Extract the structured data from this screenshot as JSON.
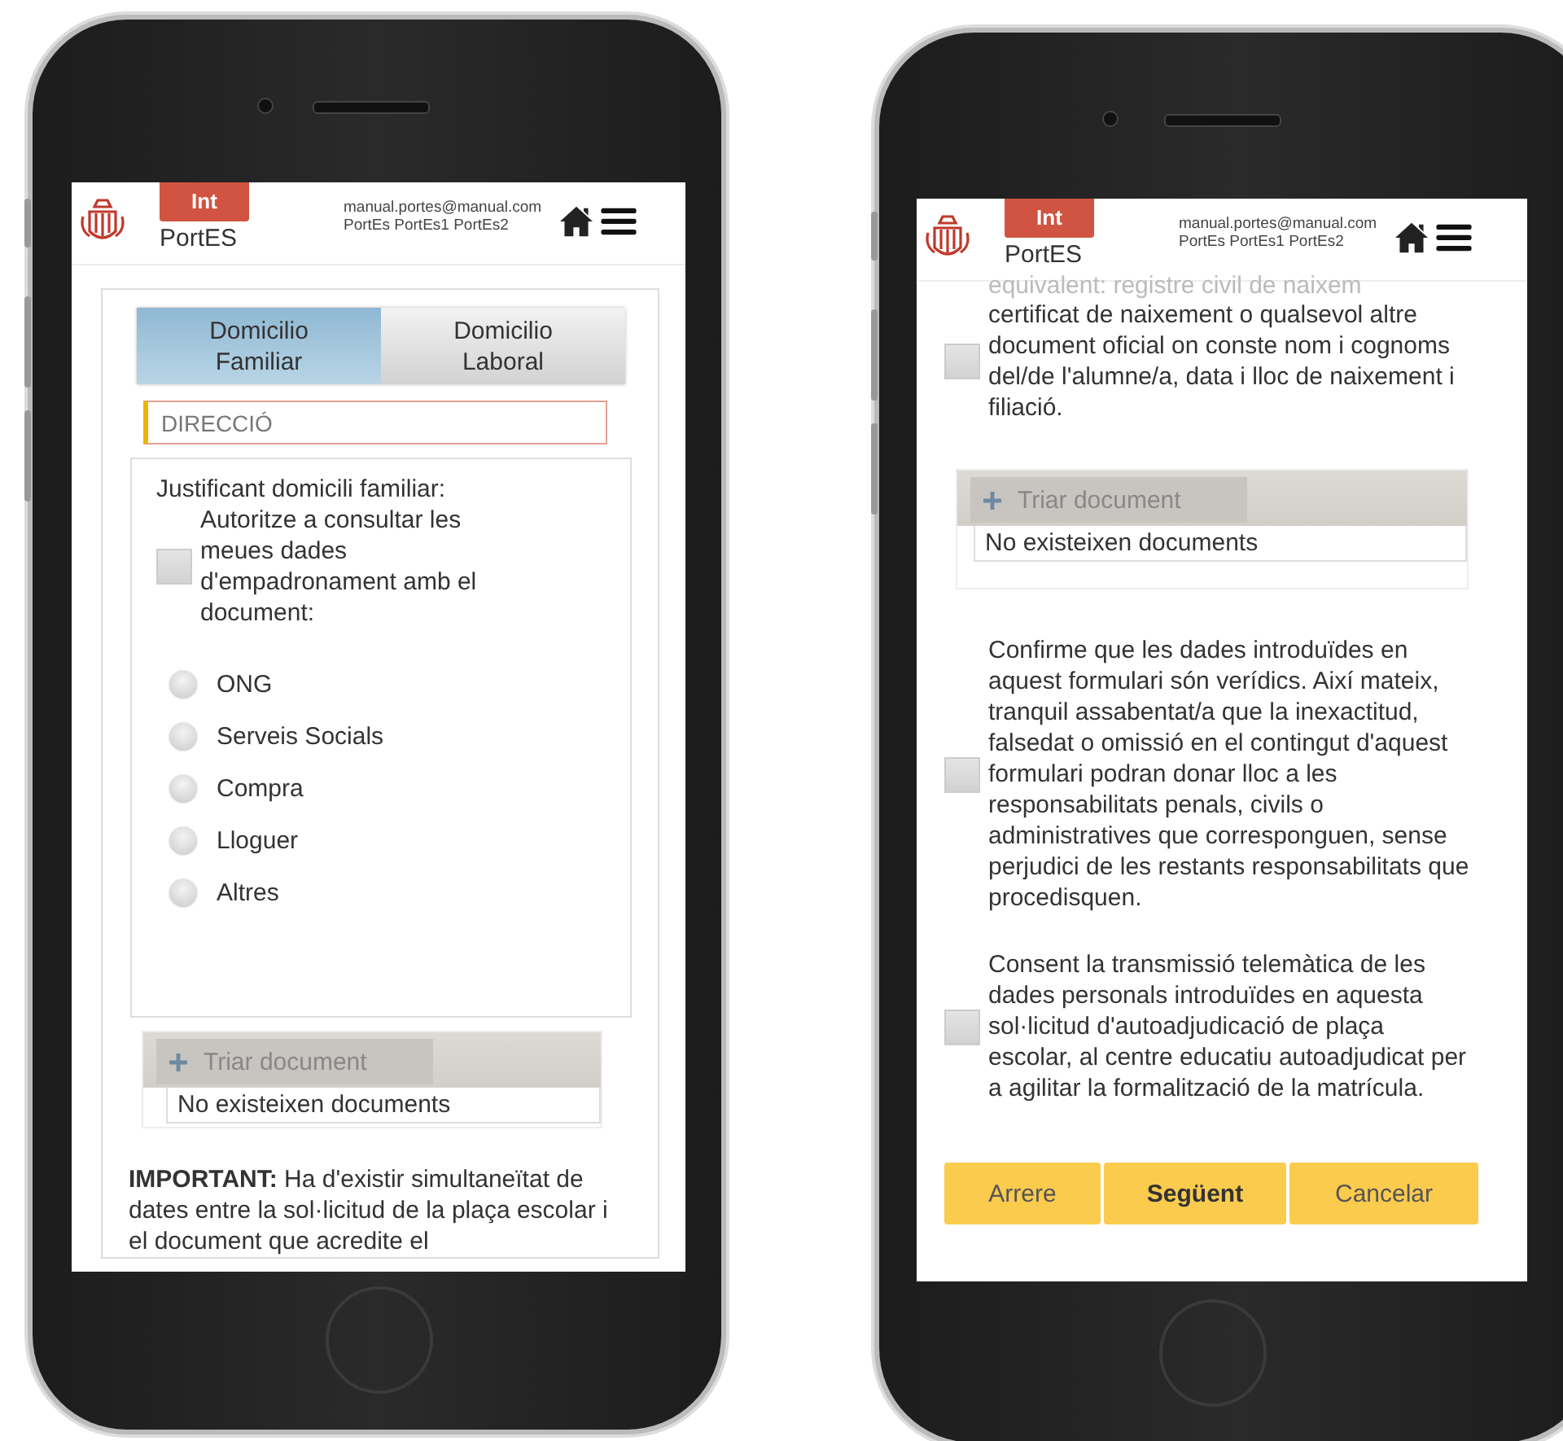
{
  "left_screen": {
    "header": {
      "badge": "Int",
      "app_name": "PortES",
      "email": "manual.portes@manual.com",
      "users": "PortEs PortEs1 PortEs2"
    },
    "tabs": [
      {
        "label": "Domicilio Familiar",
        "selected": true
      },
      {
        "label": "Domicilio Laboral",
        "selected": false
      }
    ],
    "address_field": {
      "placeholder": "DIRECCIÓ"
    },
    "proof_panel": {
      "title": "Justificant domicili familiar:",
      "consent": {
        "label": "Autoritze a consultar les meues dades d'empadronament amb el document:",
        "checked": false
      },
      "options": [
        {
          "label": "ONG",
          "selected": false
        },
        {
          "label": "Serveis Socials",
          "selected": false
        },
        {
          "label": "Compra",
          "selected": false
        },
        {
          "label": "Lloguer",
          "selected": false
        },
        {
          "label": "Altres",
          "selected": false
        }
      ]
    },
    "upload": {
      "button": "Triar document",
      "empty": "No existeixen documents"
    },
    "notice": "**IMPORTANT:** Ha d'existir simultaneïtat de dates entre la sol·licitud de la plaça escolar i el document que acredite el"
  },
  "right_screen": {
    "header": {
      "badge": "Int",
      "app_name": "PortES",
      "email": "manual.portes@manual.com",
      "users": "PortEs PortEs1 PortEs2"
    },
    "scrolled_text": "equivalent: registre civil de naixem",
    "certificate_check": {
      "label": "certificat de naixement o qualsevol altre document oficial on conste nom i cognoms del/de l'alumne/a, data i lloc de naixement i filiació.",
      "checked": false
    },
    "upload": {
      "button": "Triar document",
      "empty": "No existeixen documents"
    },
    "declarations": [
      {
        "label": "Confirme que les dades introduïdes en aquest formulari són verídics. Així mateix, tranquil assabentat/a que la inexactitud, falsedat o omissió en el contingut d'aquest formulari podran donar lloc a les responsabilitats penals, civils o administratives que corresponguen, sense perjudici de les restants responsabilitats que procedisquen.",
        "checked": false
      },
      {
        "label": "Consent la transmissió telemàtica de les dades personals introduïdes en aquesta sol·licitud d'autoadjudicació de plaça escolar, al centre educatiu autoadjudicat per a agilitar la formalització de la matrícula.",
        "checked": false
      }
    ],
    "buttons": [
      {
        "label": "Arrere",
        "kind": "secondary"
      },
      {
        "label": "Següent",
        "kind": "primary"
      },
      {
        "label": "Cancelar",
        "kind": "secondary"
      }
    ]
  }
}
